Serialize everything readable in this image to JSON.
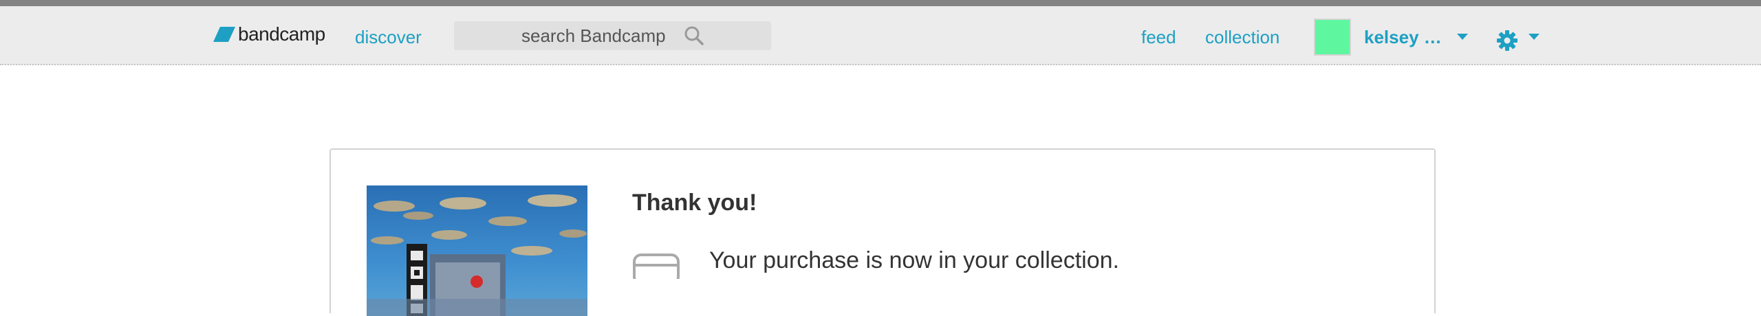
{
  "header": {
    "logo_text": "bandcamp",
    "logo_icon": "bandcamp-logo-icon",
    "nav": {
      "discover": "discover",
      "feed": "feed",
      "collection": "collection"
    },
    "search": {
      "placeholder": "search Bandcamp",
      "icon": "search-icon"
    },
    "user": {
      "name": "kelsey …",
      "avatar_color": "#5ef7a0"
    },
    "settings_icon": "gear-icon"
  },
  "confirmation": {
    "title": "Thank you!",
    "message": "Your purchase is now in your collection.",
    "icon": "collection-icon"
  },
  "colors": {
    "accent": "#1da0c3",
    "top_strip": "#838383",
    "navbar_bg": "#ececec",
    "text": "#333333"
  }
}
